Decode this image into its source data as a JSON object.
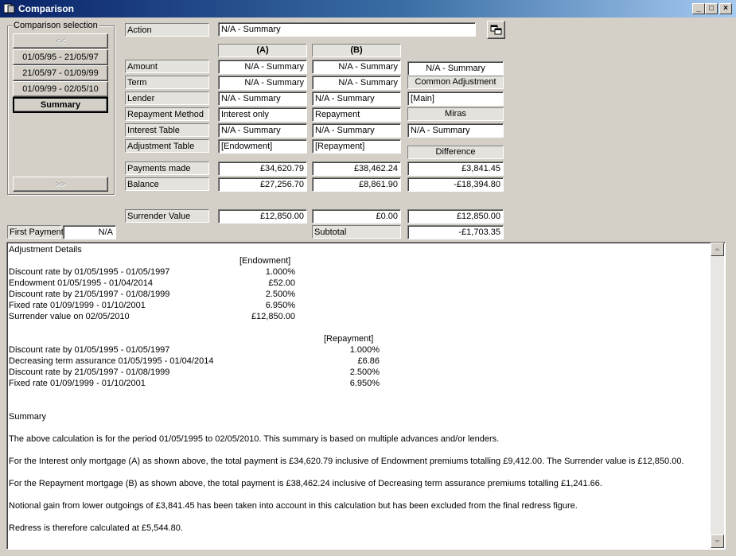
{
  "window": {
    "title": "Comparison",
    "min": "_",
    "max": "□",
    "close": "×"
  },
  "selection": {
    "label": "Comparison selection",
    "prev": "<<",
    "next": ">>",
    "items": [
      "01/05/95 - 21/05/97",
      "21/05/97 - 01/09/99",
      "01/09/99 - 02/05/10",
      "Summary"
    ]
  },
  "action": {
    "label": "Action",
    "value": "N/A - Summary"
  },
  "columns": {
    "a": "(A)",
    "b": "(B)"
  },
  "rows": {
    "amount": {
      "label": "Amount",
      "a": "N/A - Summary",
      "b": "N/A - Summary",
      "c": "N/A - Summary"
    },
    "term": {
      "label": "Term",
      "a": "N/A - Summary",
      "b": "N/A - Summary",
      "c_header": "Common Adjustment"
    },
    "lender": {
      "label": "Lender",
      "a": "N/A - Summary",
      "b": "N/A - Summary",
      "c": "[Main]"
    },
    "repayment": {
      "label": "Repayment Method",
      "a": "Interest only",
      "b": "Repayment",
      "c_header": "Miras"
    },
    "interest": {
      "label": "Interest Table",
      "a": "N/A - Summary",
      "b": "N/A - Summary",
      "c": "N/A - Summary"
    },
    "adjustment": {
      "label": "Adjustment Table",
      "a": "[Endowment]",
      "b": "[Repayment]",
      "c_header": "Difference"
    },
    "payments": {
      "label": "Payments made",
      "a": "£34,620.79",
      "b": "£38,462.24",
      "c": "£3,841.45"
    },
    "balance": {
      "label": "Balance",
      "a": "£27,256.70",
      "b": "£8,861.90",
      "c": "-£18,394.80"
    },
    "surrender": {
      "label": "Surrender Value",
      "a": "£12,850.00",
      "b": "£0.00",
      "c": "£12,850.00"
    },
    "subtotal": {
      "label": "Subtotal",
      "c": "-£1,703.35"
    }
  },
  "first_payment": {
    "label": "First Payment",
    "value": "N/A"
  },
  "report": {
    "heading": "Adjustment Details",
    "endowment": {
      "header": "[Endowment]",
      "lines": [
        {
          "label": "Discount rate by 01/05/1995 - 01/05/1997",
          "value": "1.000%"
        },
        {
          "label": "Endowment 01/05/1995 - 01/04/2014",
          "value": "£52.00"
        },
        {
          "label": "Discount rate by 21/05/1997 - 01/08/1999",
          "value": "2.500%"
        },
        {
          "label": "Fixed rate 01/09/1999 - 01/10/2001",
          "value": "6.950%"
        },
        {
          "label": "Surrender value on 02/05/2010",
          "value": "£12,850.00"
        }
      ]
    },
    "repayment": {
      "header": "[Repayment]",
      "lines": [
        {
          "label": "Discount rate by 01/05/1995 - 01/05/1997",
          "value": "1.000%"
        },
        {
          "label": "Decreasing term assurance 01/05/1995 - 01/04/2014",
          "value": "£6.86"
        },
        {
          "label": "Discount rate by 21/05/1997 - 01/08/1999",
          "value": "2.500%"
        },
        {
          "label": "Fixed rate 01/09/1999 - 01/10/2001",
          "value": "6.950%"
        }
      ]
    },
    "summary_heading": "Summary",
    "paragraphs": [
      "The above calculation is for the period 01/05/1995 to 02/05/2010. This summary is based on multiple advances and/or lenders.",
      "For the Interest only mortgage (A) as shown above, the total payment is £34,620.79 inclusive of Endowment premiums totalling £9,412.00. The Surrender value is £12,850.00.",
      "For the Repayment mortgage (B) as shown above, the total payment is £38,462.24 inclusive of Decreasing term assurance premiums totalling £1,241.66.",
      "Notional gain from lower outgoings of £3,841.45 has been taken into account in this calculation but has been excluded from the final redress figure.",
      "Redress is therefore calculated at £5,544.80."
    ]
  }
}
